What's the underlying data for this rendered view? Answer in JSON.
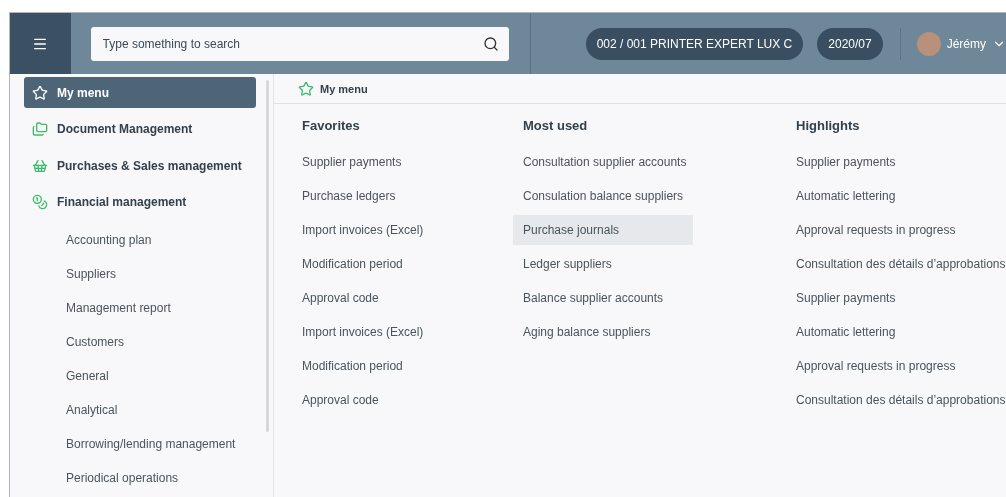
{
  "header": {
    "search": {
      "placeholder": "Type something to search"
    },
    "company": "002 / 001 PRINTER EXPERT LUX C",
    "period": "2020/07",
    "user": {
      "name": "Jérémy"
    }
  },
  "sidebar": {
    "items": [
      {
        "label": "My menu",
        "kind": "star",
        "selected": true
      },
      {
        "label": "Document Management",
        "kind": "folder",
        "selected": false
      },
      {
        "label": "Purchases & Sales management",
        "kind": "basket",
        "selected": false
      },
      {
        "label": "Financial management",
        "kind": "coins",
        "selected": false,
        "children": [
          {
            "label": "Accounting plan"
          },
          {
            "label": "Suppliers"
          },
          {
            "label": "Management report"
          },
          {
            "label": "Customers"
          },
          {
            "label": "General"
          },
          {
            "label": "Analytical"
          },
          {
            "label": "Borrowing/lending management"
          },
          {
            "label": "Periodical operations"
          }
        ]
      }
    ]
  },
  "content": {
    "title": "My menu",
    "columns": [
      {
        "heading": "Favorites",
        "items": [
          {
            "label": "Supplier payments",
            "selected": false
          },
          {
            "label": "Purchase ledgers",
            "selected": false
          },
          {
            "label": "Import invoices (Excel)",
            "selected": false
          },
          {
            "label": "Modification period",
            "selected": false
          },
          {
            "label": "Approval code",
            "selected": false
          },
          {
            "label": "Import invoices (Excel)",
            "selected": false
          },
          {
            "label": "Modification period",
            "selected": false
          },
          {
            "label": "Approval code",
            "selected": false
          }
        ]
      },
      {
        "heading": "Most used",
        "items": [
          {
            "label": "Consultation supplier accounts",
            "selected": false
          },
          {
            "label": "Consulation balance suppliers",
            "selected": false
          },
          {
            "label": "Purchase journals",
            "selected": true
          },
          {
            "label": "Ledger suppliers",
            "selected": false
          },
          {
            "label": "Balance supplier accounts",
            "selected": false
          },
          {
            "label": "Aging balance suppliers",
            "selected": false
          }
        ]
      },
      {
        "heading": "Highlights",
        "items": [
          {
            "label": "Supplier payments",
            "selected": false
          },
          {
            "label": "Automatic lettering",
            "selected": false
          },
          {
            "label": "Approval requests in progress",
            "selected": false
          },
          {
            "label": "Consultation des détails d’approbations",
            "selected": false
          },
          {
            "label": "Supplier payments",
            "selected": false
          },
          {
            "label": "Automatic lettering",
            "selected": false
          },
          {
            "label": "Approval requests in progress",
            "selected": false
          },
          {
            "label": "Consultation des détails d’approbations",
            "selected": false
          }
        ]
      }
    ]
  }
}
